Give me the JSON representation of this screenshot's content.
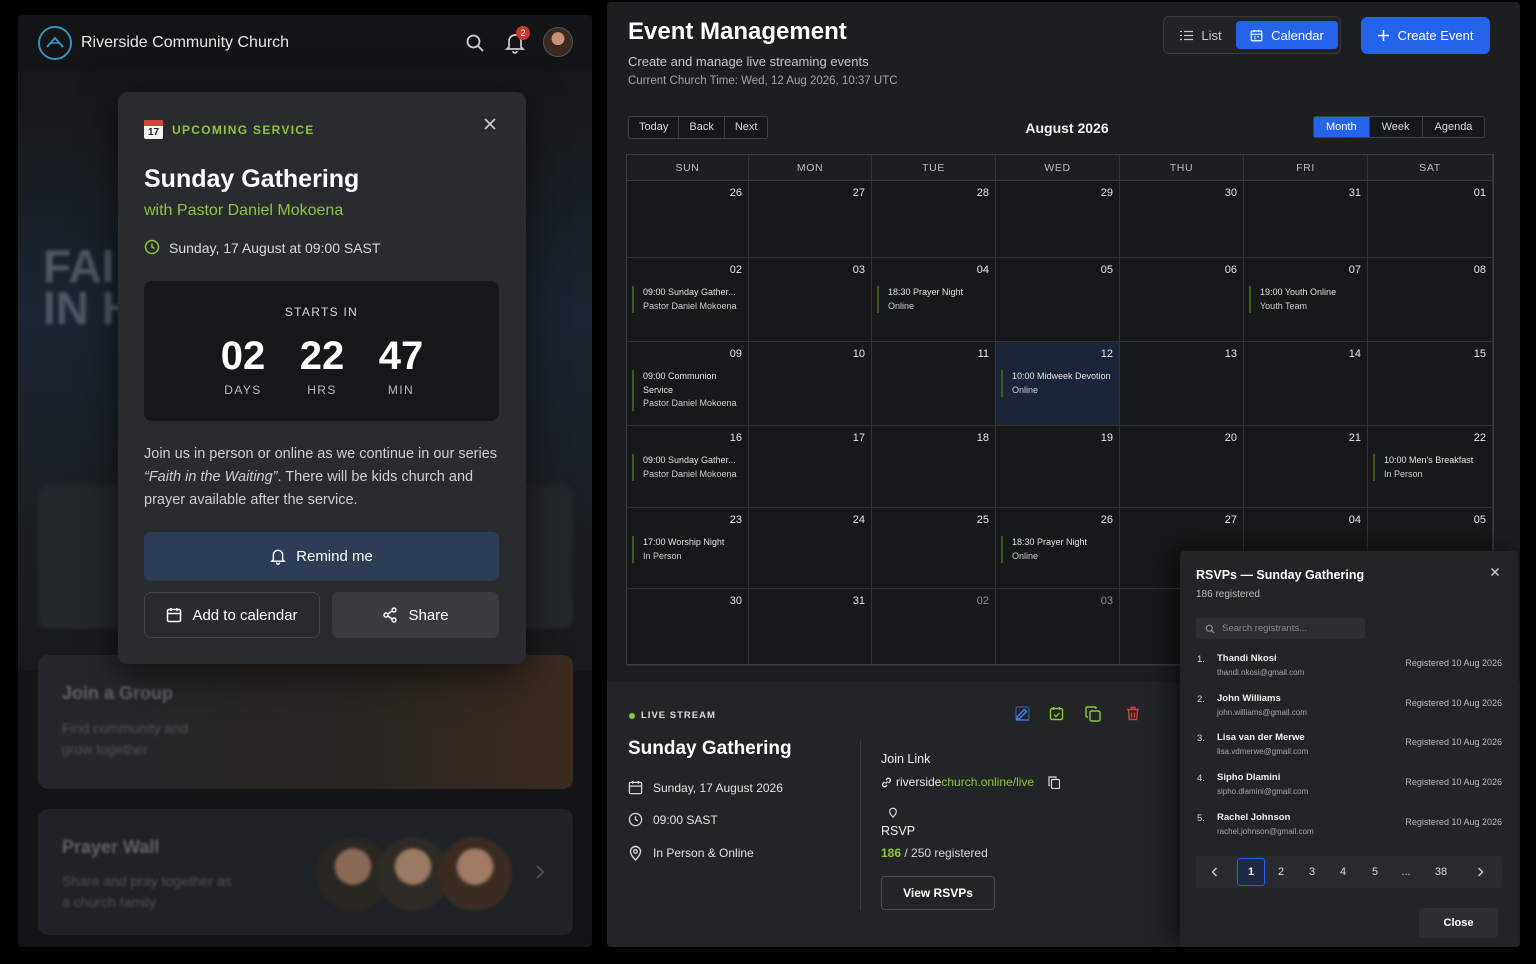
{
  "left": {
    "church_name": "Riverside Community Church",
    "notification_count": "2",
    "bg_hero_text": "FAI\nIN H",
    "bg_group_title": "Join a Group",
    "bg_group_sub": "Find community and grow together",
    "bg_prayer_title": "Prayer Wall",
    "bg_prayer_sub": "Share and pray together as a church family"
  },
  "popup": {
    "label": "UPCOMING SERVICE",
    "calendar_emoji_num": "17",
    "title": "Sunday Gathering",
    "pastor": "with Pastor Daniel Mokoena",
    "datetime": "Sunday, 17 August at 09:00 SAST",
    "starts_in": "STARTS IN",
    "countdown": [
      {
        "value": "02",
        "unit": "DAYS"
      },
      {
        "value": "22",
        "unit": "HRS"
      },
      {
        "value": "47",
        "unit": "MIN"
      }
    ],
    "desc_before": "Join us in person or online as we continue in our series ",
    "desc_series": "“Faith in the Waiting”",
    "desc_after": ". There will be kids church and prayer available after the service.",
    "remind_label": "Remind me",
    "add_calendar_label": "Add to calendar",
    "share_label": "Share"
  },
  "header": {
    "title": "Event Management",
    "subtitle": "Create and manage live streaming events",
    "church_time": "Current Church Time: Wed, 12 Aug 2026, 10:37 UTC",
    "list_label": "List",
    "calendar_label": "Calendar",
    "create_label": "Create Event"
  },
  "calendar": {
    "nav": [
      "Today",
      "Back",
      "Next"
    ],
    "month_label": "August 2026",
    "views": [
      "Month",
      "Week",
      "Agenda"
    ],
    "active_view": "Month",
    "days_of_week": [
      "SUN",
      "MON",
      "TUE",
      "WED",
      "THU",
      "FRI",
      "SAT"
    ],
    "weeks": [
      [
        {
          "d": "26"
        },
        {
          "d": "27"
        },
        {
          "d": "28"
        },
        {
          "d": "29"
        },
        {
          "d": "30"
        },
        {
          "d": "31"
        },
        {
          "d": "01"
        }
      ],
      [
        {
          "d": "02",
          "ev": [
            "09:00 Sunday Gather...",
            "Pastor Daniel Mokoena"
          ]
        },
        {
          "d": "03"
        },
        {
          "d": "04",
          "ev": [
            "18:30 Prayer Night",
            "Online"
          ]
        },
        {
          "d": "05"
        },
        {
          "d": "06"
        },
        {
          "d": "07",
          "ev": [
            "19:00 Youth Online",
            "Youth Team"
          ]
        },
        {
          "d": "08"
        }
      ],
      [
        {
          "d": "09",
          "ev": [
            "09:00 Communion Service",
            "Pastor Daniel Mokoena"
          ]
        },
        {
          "d": "10"
        },
        {
          "d": "11"
        },
        {
          "d": "12",
          "today": true,
          "ev": [
            "10:00 Midweek Devotion",
            "Online"
          ]
        },
        {
          "d": "13"
        },
        {
          "d": "14"
        },
        {
          "d": "15"
        }
      ],
      [
        {
          "d": "16",
          "ev": [
            "09:00 Sunday Gather...",
            "Pastor Daniel Mokoena"
          ]
        },
        {
          "d": "17"
        },
        {
          "d": "18"
        },
        {
          "d": "19"
        },
        {
          "d": "20"
        },
        {
          "d": "21"
        },
        {
          "d": "22",
          "ev": [
            "10:00 Men's Breakfast",
            "In Person"
          ]
        }
      ],
      [
        {
          "d": "23",
          "ev": [
            "17:00 Worship Night",
            "In Person"
          ]
        },
        {
          "d": "24"
        },
        {
          "d": "25"
        },
        {
          "d": "26",
          "ev": [
            "18:30 Prayer Night",
            "Online"
          ]
        },
        {
          "d": "27"
        },
        {
          "d": "04"
        },
        {
          "d": "05"
        }
      ],
      [
        {
          "d": "30"
        },
        {
          "d": "31"
        },
        {
          "d": "02",
          "off": true
        },
        {
          "d": "03",
          "off": true
        },
        {
          "d": ""
        },
        {
          "d": ""
        },
        {
          "d": ""
        }
      ]
    ]
  },
  "live": {
    "label": "LIVE STREAM",
    "title": "Sunday Gathering",
    "date": "Sunday, 17 August 2026",
    "time": "09:00 SAST",
    "mode": "In Person & Online",
    "join_label": "Join Link",
    "link_domain": "riverside",
    "link_tld": "church.online/live",
    "rsvp_label": "RSVP",
    "rsvp_count": "186",
    "rsvp_total": " / 250 registered",
    "view_rsvps_label": "View RSVPs"
  },
  "rsvp": {
    "title": "RSVPs — Sunday Gathering",
    "subtitle": "186 registered",
    "search_placeholder": "Search registrants...",
    "registrants": [
      {
        "idx": "1.",
        "name": "Thandi Nkosi",
        "email": "thandi.nkosi@gmail.com",
        "date": "Registered 10 Aug 2026"
      },
      {
        "idx": "2.",
        "name": "John Williams",
        "email": "john.williams@gmail.com",
        "date": "Registered 10 Aug 2026"
      },
      {
        "idx": "3.",
        "name": "Lisa van der Merwe",
        "email": "lisa.vdmerwe@gmail.com",
        "date": "Registered 10 Aug 2026"
      },
      {
        "idx": "4.",
        "name": "Sipho Dlamini",
        "email": "sipho.dlamini@gmail.com",
        "date": "Registered 10 Aug 2026"
      },
      {
        "idx": "5.",
        "name": "Rachel Johnson",
        "email": "rachel.johnson@gmail.com",
        "date": "Registered 10 Aug 2026"
      }
    ],
    "pages": [
      "1",
      "2",
      "3",
      "4",
      "5",
      "...",
      "38"
    ],
    "active_page": "1",
    "close_label": "Close"
  },
  "colors": {
    "accent": "#2563eb",
    "green": "#8dc63f",
    "danger": "#d0433b"
  }
}
